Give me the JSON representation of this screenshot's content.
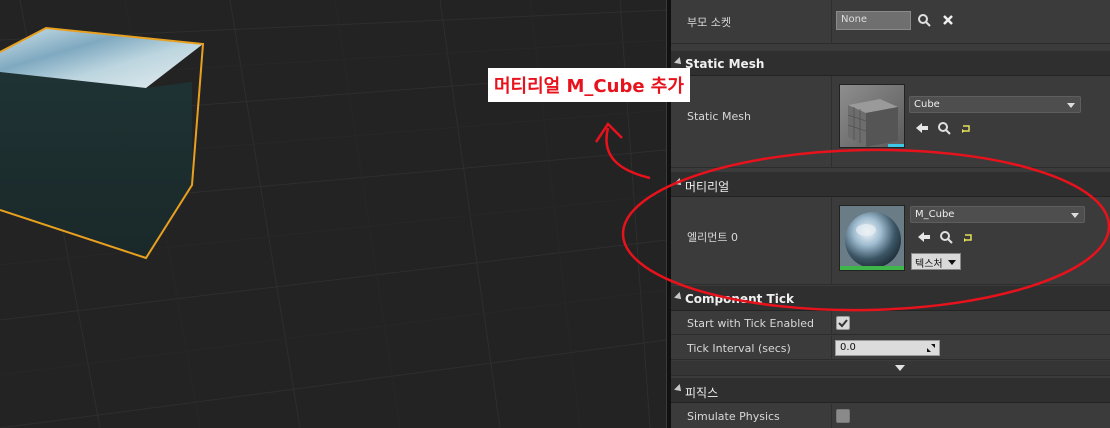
{
  "annotation": {
    "text": "머티리얼 M_Cube 추가",
    "color": "#e8121c"
  },
  "details": {
    "parent_socket": {
      "label": "부모 소켓",
      "value": "None"
    },
    "static_mesh_category": {
      "label": "Static Mesh"
    },
    "static_mesh": {
      "label": "Static Mesh",
      "value": "Cube"
    },
    "material_category": {
      "label": "머티리얼"
    },
    "element0": {
      "label": "엘리먼트 0",
      "value": "M_Cube",
      "texture_button": "텍스처"
    },
    "component_tick_category": {
      "label": "Component Tick"
    },
    "start_with_tick": {
      "label": "Start with Tick Enabled",
      "checked": true
    },
    "tick_interval": {
      "label": "Tick Interval (secs)",
      "value": "0.0"
    },
    "physics_category": {
      "label": "피직스"
    },
    "simulate_physics": {
      "label": "Simulate Physics",
      "checked": false
    }
  },
  "icons": [
    "search-icon",
    "clear-icon",
    "use-selected-arrow-icon",
    "browse-icon",
    "reset-icon",
    "dropdown-arrow-icon",
    "expand-arrow-icon"
  ],
  "colors": {
    "selection_outline": "#e8a020",
    "panel_bg": "#3b3b3b",
    "category_bg": "#2f2f2f"
  }
}
